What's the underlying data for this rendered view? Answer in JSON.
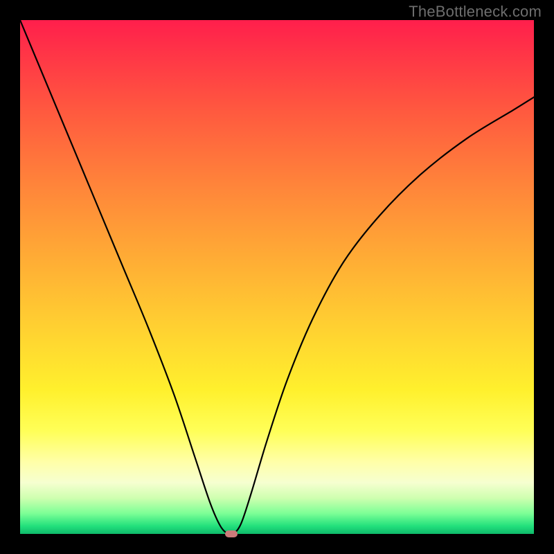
{
  "watermark": "TheBottleneck.com",
  "chart_data": {
    "type": "line",
    "title": "",
    "xlabel": "",
    "ylabel": "",
    "xlim": [
      0,
      1
    ],
    "ylim": [
      0,
      1
    ],
    "grid": false,
    "series": [
      {
        "name": "bottleneck-curve",
        "x": [
          0.0,
          0.05,
          0.1,
          0.15,
          0.2,
          0.25,
          0.3,
          0.34,
          0.37,
          0.39,
          0.405,
          0.415,
          0.43,
          0.45,
          0.48,
          0.52,
          0.57,
          0.63,
          0.7,
          0.78,
          0.87,
          0.96,
          1.0
        ],
        "y": [
          1.0,
          0.88,
          0.76,
          0.64,
          0.52,
          0.4,
          0.27,
          0.15,
          0.06,
          0.015,
          0.0,
          0.0,
          0.02,
          0.08,
          0.18,
          0.3,
          0.42,
          0.53,
          0.62,
          0.7,
          0.77,
          0.825,
          0.85
        ]
      }
    ],
    "marker": {
      "x": 0.411,
      "y": 0.0
    },
    "background_gradient": {
      "top": "#ff1f4c",
      "upper_mid": "#ffab35",
      "mid": "#ffff58",
      "lower_mid": "#cfffb0",
      "bottom": "#0fb96a"
    }
  }
}
